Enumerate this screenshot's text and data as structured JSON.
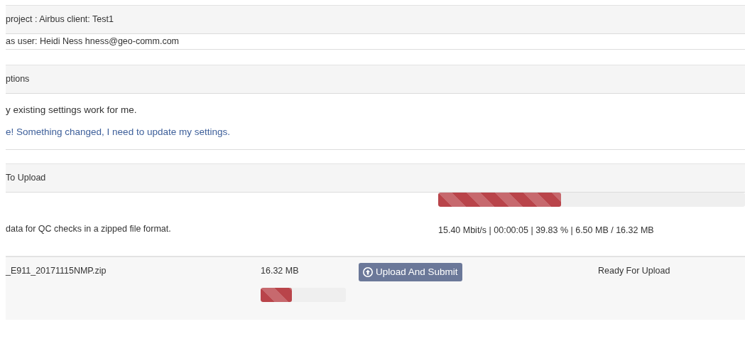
{
  "project_header": {
    "text": "project : Airbus client: Test1"
  },
  "user_line": {
    "text": "as user: Heidi Ness hness@geo-comm.com"
  },
  "options_header": {
    "text": "ptions"
  },
  "options": [
    {
      "kind": "text",
      "text": "y existing settings work for me."
    },
    {
      "kind": "link",
      "text": "e! Something changed, I need to update my settings."
    }
  ],
  "upload_header": {
    "text": "To Upload"
  },
  "overall_progress": {
    "level": 0.4,
    "description": "data for QC checks in a zipped file format.",
    "stats": "15.40 Mbit/s | 00:00:05 | 39.83 % | 6.50 MB / 16.32 MB"
  },
  "files": [
    {
      "name": "_E911_20171115NMP.zip",
      "size": "16.32 MB",
      "level": 0.37,
      "button": "Upload And Submit",
      "status": "Ready For Upload"
    }
  ]
}
